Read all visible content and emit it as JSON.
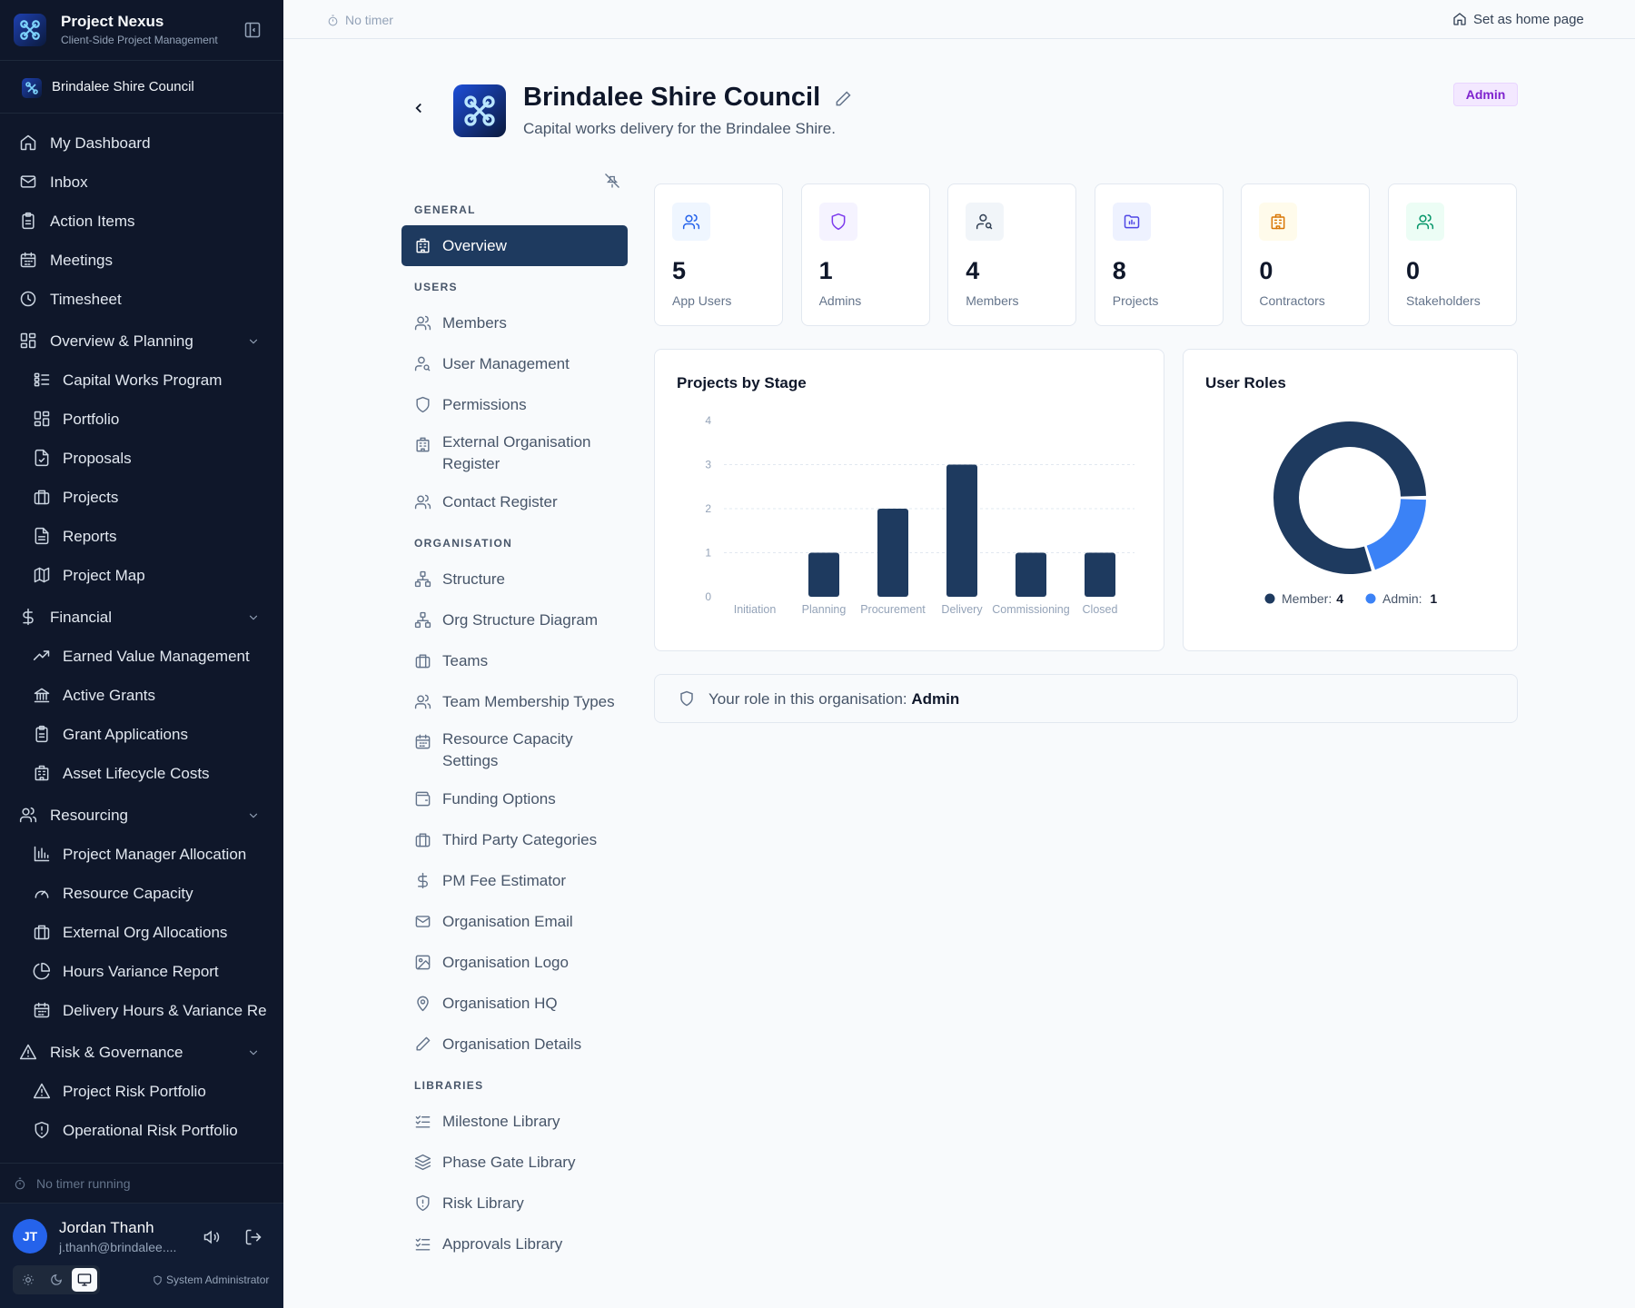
{
  "app": {
    "name": "Project Nexus",
    "tagline": "Client-Side Project Management"
  },
  "sidebar": {
    "org_name": "Brindalee Shire Council",
    "items": [
      {
        "label": "My Dashboard",
        "icon": "home-icon"
      },
      {
        "label": "Inbox",
        "icon": "mail-icon"
      },
      {
        "label": "Action Items",
        "icon": "clipboard-icon"
      },
      {
        "label": "Meetings",
        "icon": "calendar-icon"
      },
      {
        "label": "Timesheet",
        "icon": "clock-icon"
      },
      {
        "label": "Overview & Planning",
        "icon": "grid-icon",
        "group": true
      },
      {
        "label": "Capital Works Program",
        "icon": "list-icon",
        "sub": true
      },
      {
        "label": "Portfolio",
        "icon": "grid-icon",
        "sub": true
      },
      {
        "label": "Proposals",
        "icon": "file-icon",
        "sub": true
      },
      {
        "label": "Projects",
        "icon": "briefcase-icon",
        "sub": true
      },
      {
        "label": "Reports",
        "icon": "file-text-icon",
        "sub": true
      },
      {
        "label": "Project Map",
        "icon": "map-icon",
        "sub": true
      },
      {
        "label": "Financial",
        "icon": "dollar-icon",
        "group": true
      },
      {
        "label": "Earned Value Management",
        "icon": "trend-icon",
        "sub": true
      },
      {
        "label": "Active Grants",
        "icon": "bank-icon",
        "sub": true
      },
      {
        "label": "Grant Applications",
        "icon": "clipboard-icon",
        "sub": true
      },
      {
        "label": "Asset Lifecycle Costs",
        "icon": "building-icon",
        "sub": true
      },
      {
        "label": "Resourcing",
        "icon": "users-icon",
        "group": true
      },
      {
        "label": "Project Manager Allocation",
        "icon": "bar-chart-icon",
        "sub": true
      },
      {
        "label": "Resource Capacity",
        "icon": "gauge-icon",
        "sub": true
      },
      {
        "label": "External Org Allocations",
        "icon": "briefcase-icon",
        "sub": true
      },
      {
        "label": "Hours Variance Report",
        "icon": "pie-icon",
        "sub": true
      },
      {
        "label": "Delivery Hours & Variance Re",
        "icon": "calendar-icon",
        "sub": true
      },
      {
        "label": "Risk & Governance",
        "icon": "warning-icon",
        "group": true
      },
      {
        "label": "Project Risk Portfolio",
        "icon": "warning-icon",
        "sub": true
      },
      {
        "label": "Operational Risk Portfolio",
        "icon": "shield-alert-icon",
        "sub": true
      }
    ],
    "timer_status": "No timer running",
    "user": {
      "initials": "JT",
      "name": "Jordan Thanh",
      "email": "j.thanh@brindalee....",
      "role": "System Administrator"
    }
  },
  "topbar": {
    "timer": "No timer",
    "home_label": "Set as home page"
  },
  "header": {
    "title": "Brindalee Shire Council",
    "description": "Capital works delivery for the Brindalee Shire.",
    "role_badge": "Admin"
  },
  "settings_menu": {
    "sections": [
      {
        "title": "GENERAL",
        "items": [
          {
            "label": "Overview",
            "icon": "building-icon",
            "active": true
          }
        ]
      },
      {
        "title": "USERS",
        "items": [
          {
            "label": "Members",
            "icon": "users-icon"
          },
          {
            "label": "User Management",
            "icon": "user-search-icon"
          },
          {
            "label": "Permissions",
            "icon": "shield-icon"
          },
          {
            "label": "External Organisation Register",
            "icon": "building-icon"
          },
          {
            "label": "Contact Register",
            "icon": "users-icon"
          }
        ]
      },
      {
        "title": "ORGANISATION",
        "items": [
          {
            "label": "Structure",
            "icon": "network-icon"
          },
          {
            "label": "Org Structure Diagram",
            "icon": "network-icon"
          },
          {
            "label": "Teams",
            "icon": "briefcase-icon"
          },
          {
            "label": "Team Membership Types",
            "icon": "users-icon"
          },
          {
            "label": "Resource Capacity Settings",
            "icon": "calendar-icon"
          },
          {
            "label": "Funding Options",
            "icon": "wallet-icon"
          },
          {
            "label": "Third Party Categories",
            "icon": "briefcase-icon"
          },
          {
            "label": "PM Fee Estimator",
            "icon": "dollar-icon"
          },
          {
            "label": "Organisation Email",
            "icon": "mail-icon"
          },
          {
            "label": "Organisation Logo",
            "icon": "image-icon"
          },
          {
            "label": "Organisation HQ",
            "icon": "pin-icon"
          },
          {
            "label": "Organisation Details",
            "icon": "pencil-icon"
          }
        ]
      },
      {
        "title": "LIBRARIES",
        "items": [
          {
            "label": "Milestone Library",
            "icon": "checklist-icon"
          },
          {
            "label": "Phase Gate Library",
            "icon": "layers-icon"
          },
          {
            "label": "Risk Library",
            "icon": "shield-alert-icon"
          },
          {
            "label": "Approvals Library",
            "icon": "checklist-icon"
          }
        ]
      }
    ]
  },
  "stats": [
    {
      "value": "5",
      "label": "App Users",
      "icon": "users-icon",
      "bg": "#eff6ff",
      "fg": "#2563eb"
    },
    {
      "value": "1",
      "label": "Admins",
      "icon": "shield-icon",
      "bg": "#f5f3ff",
      "fg": "#7c3aed"
    },
    {
      "value": "4",
      "label": "Members",
      "icon": "user-search-icon",
      "bg": "#f1f5f9",
      "fg": "#334155"
    },
    {
      "value": "8",
      "label": "Projects",
      "icon": "folder-chart-icon",
      "bg": "#eef2ff",
      "fg": "#4f46e5"
    },
    {
      "value": "0",
      "label": "Contractors",
      "icon": "building-icon",
      "bg": "#fffbeb",
      "fg": "#d97706"
    },
    {
      "value": "0",
      "label": "Stakeholders",
      "icon": "users-icon",
      "bg": "#ecfdf5",
      "fg": "#059669"
    }
  ],
  "banner": {
    "text": "Your role in this organisation:",
    "value": "Admin"
  },
  "chart_data": [
    {
      "type": "bar",
      "title": "Projects by Stage",
      "categories": [
        "Initiation",
        "Planning",
        "Procurement",
        "Delivery",
        "Commissioning",
        "Closed"
      ],
      "values": [
        0,
        1,
        2,
        3,
        1,
        1
      ],
      "ylim": [
        0,
        4
      ],
      "yticks": [
        "0",
        "1",
        "2",
        "3",
        "4"
      ],
      "grid": true,
      "color": "#1e3a5f"
    },
    {
      "type": "pie",
      "title": "User Roles",
      "donut": true,
      "legend_position": "bottom",
      "slices": [
        {
          "name": "Member",
          "value": 4,
          "color": "#1e3a5f"
        },
        {
          "name": "Admin",
          "value": 1,
          "color": "#3b82f6"
        }
      ]
    }
  ]
}
